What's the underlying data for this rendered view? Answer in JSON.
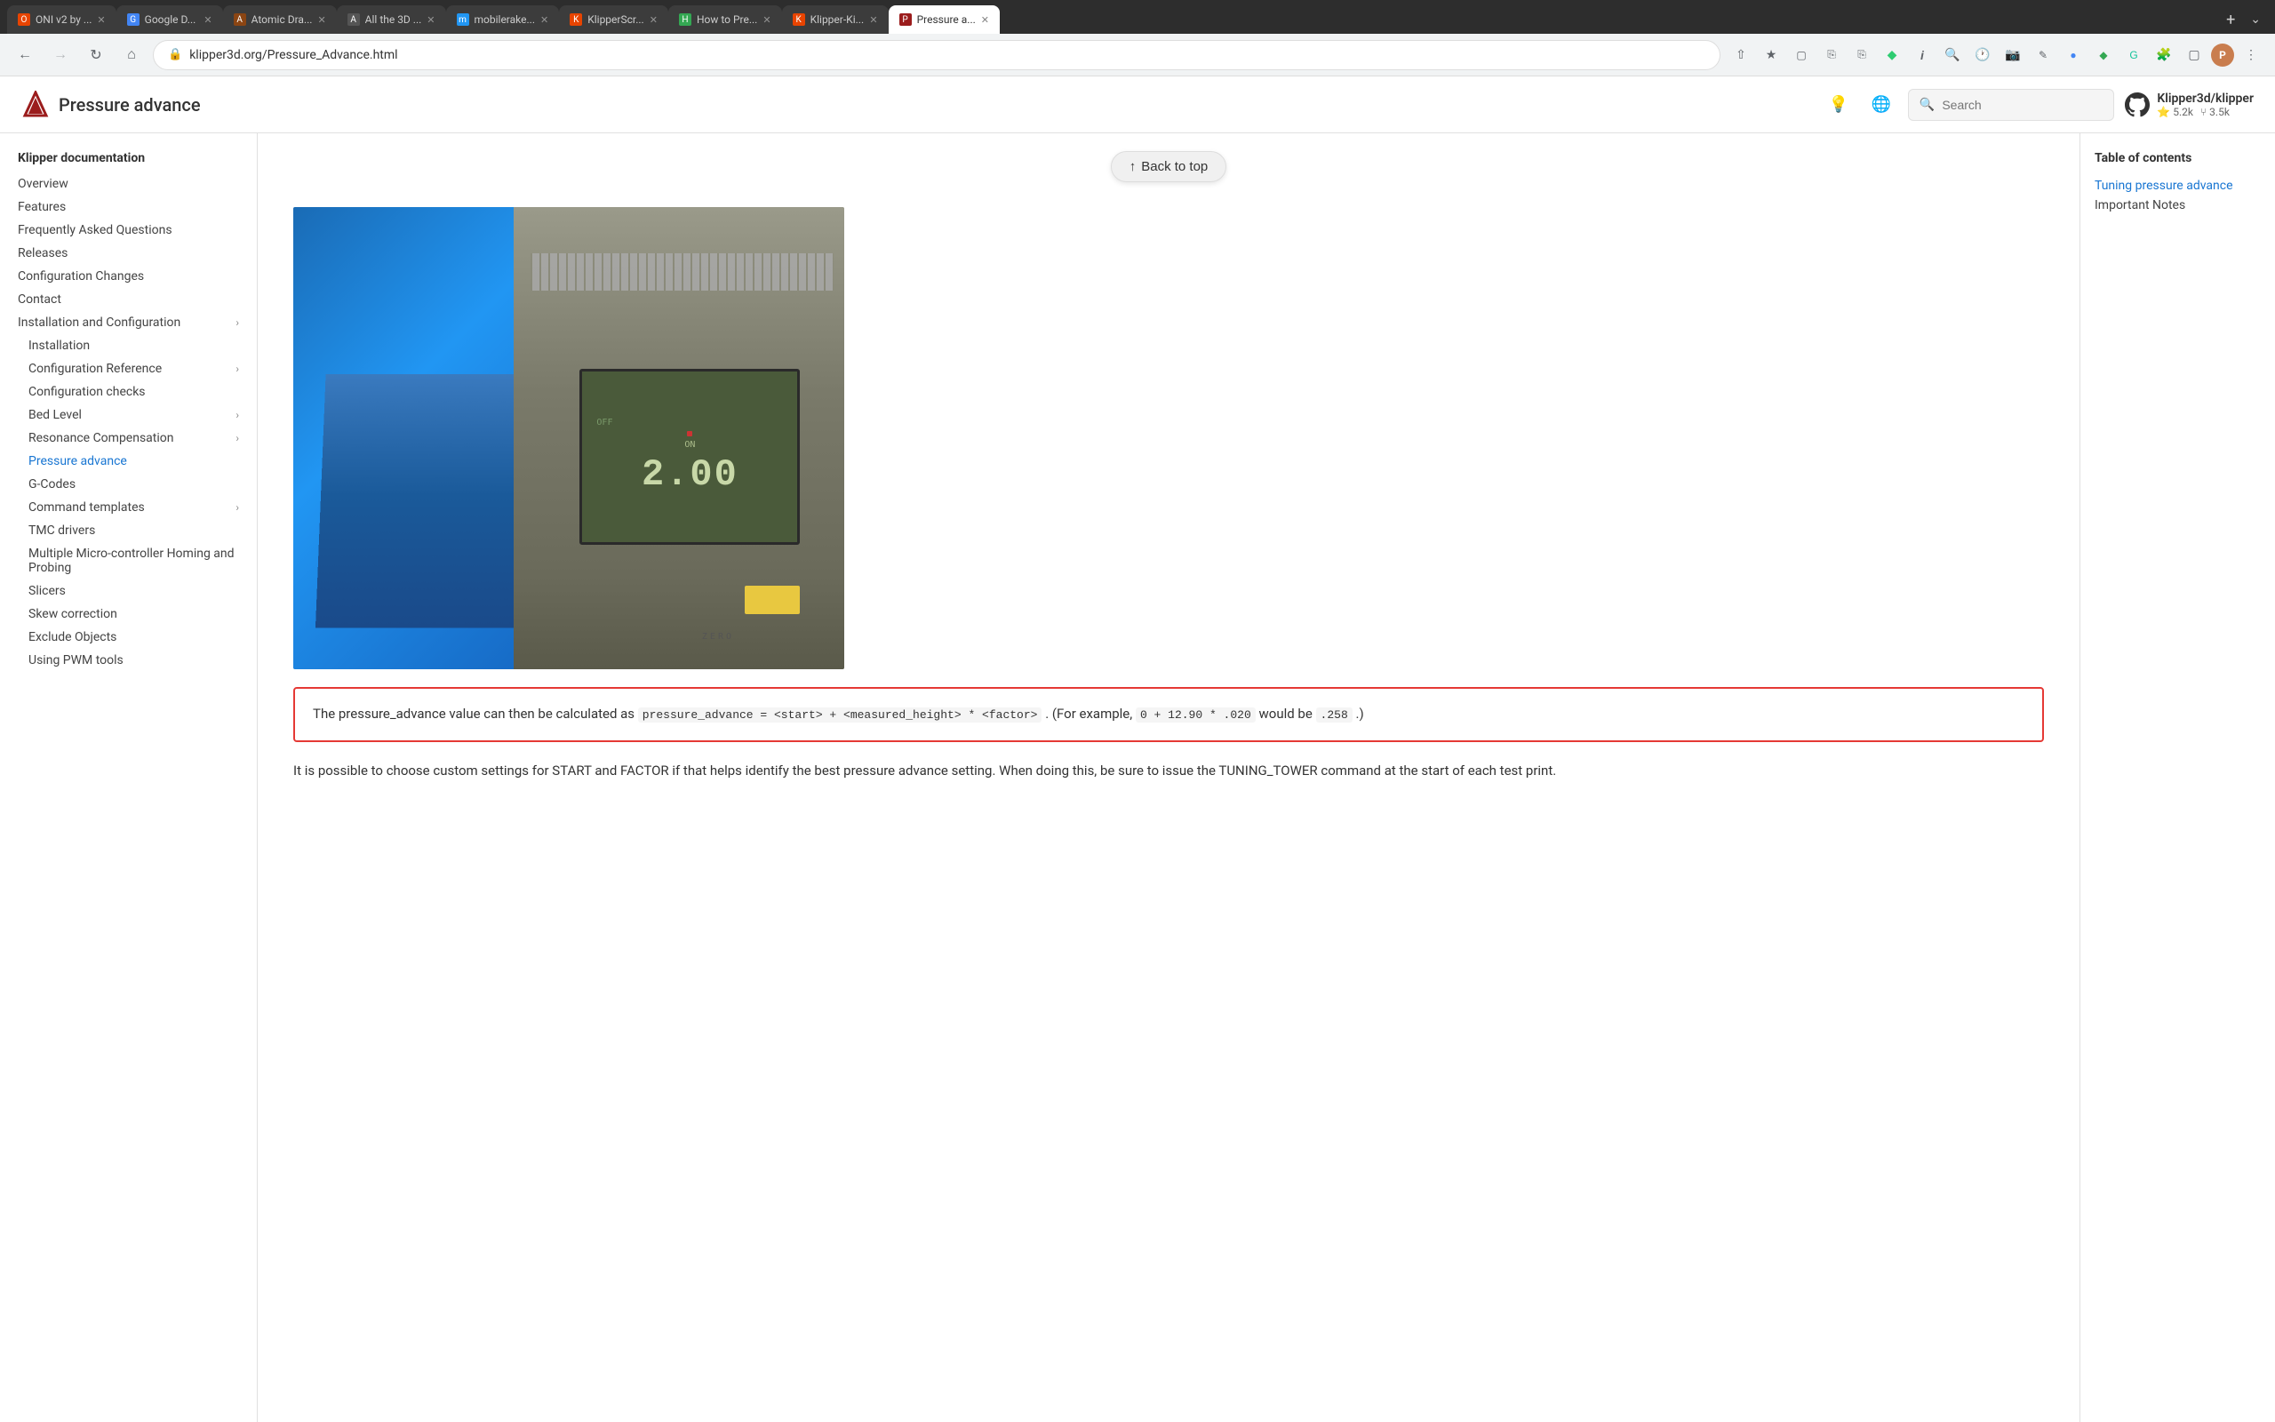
{
  "browser": {
    "tabs": [
      {
        "id": "tab1",
        "favicon_color": "#e84400",
        "favicon_text": "O",
        "label": "ONI v2 by ...",
        "active": false
      },
      {
        "id": "tab2",
        "favicon_color": "#4285f4",
        "favicon_text": "G",
        "label": "Google D...",
        "active": false
      },
      {
        "id": "tab3",
        "favicon_color": "#8B4513",
        "favicon_text": "A",
        "label": "Atomic Dra...",
        "active": false
      },
      {
        "id": "tab4",
        "favicon_color": "#555",
        "favicon_text": "A",
        "label": "All the 3D ...",
        "active": false
      },
      {
        "id": "tab5",
        "favicon_color": "#2196f3",
        "favicon_text": "m",
        "label": "mobilerake...",
        "active": false
      },
      {
        "id": "tab6",
        "favicon_color": "#e84400",
        "favicon_text": "K",
        "label": "KlipperScr...",
        "active": false
      },
      {
        "id": "tab7",
        "favicon_color": "#34a853",
        "favicon_text": "H",
        "label": "How to Pre...",
        "active": false
      },
      {
        "id": "tab8",
        "favicon_color": "#e84400",
        "favicon_text": "K",
        "label": "Klipper-Ki...",
        "active": false
      },
      {
        "id": "tab9",
        "favicon_color": "#9b1c1c",
        "favicon_text": "P",
        "label": "Pressure a...",
        "active": true
      }
    ],
    "url": "klipper3d.org/Pressure_Advance.html",
    "new_tab_label": "+",
    "tab_overflow_label": "⌄"
  },
  "top_nav": {
    "logo_alt": "Klipper",
    "title": "Pressure advance",
    "theme_icon": "💡",
    "lang_icon": "🌐",
    "search_placeholder": "Search",
    "github_icon": "⭕",
    "github_repo": "Klipper3d/klipper",
    "github_stars": "⭐ 5.2k",
    "github_forks": "⑂ 3.5k"
  },
  "sidebar": {
    "section_title": "Klipper documentation",
    "items": [
      {
        "label": "Overview",
        "indent": false,
        "has_chevron": false,
        "active": false
      },
      {
        "label": "Features",
        "indent": false,
        "has_chevron": false,
        "active": false
      },
      {
        "label": "Frequently Asked Questions",
        "indent": false,
        "has_chevron": false,
        "active": false
      },
      {
        "label": "Releases",
        "indent": false,
        "has_chevron": false,
        "active": false
      },
      {
        "label": "Configuration Changes",
        "indent": false,
        "has_chevron": false,
        "active": false
      },
      {
        "label": "Contact",
        "indent": false,
        "has_chevron": false,
        "active": false
      },
      {
        "label": "Installation and Configuration",
        "indent": false,
        "has_chevron": true,
        "active": false
      },
      {
        "label": "Installation",
        "indent": true,
        "has_chevron": false,
        "active": false
      },
      {
        "label": "Configuration Reference",
        "indent": true,
        "has_chevron": true,
        "active": false
      },
      {
        "label": "Configuration checks",
        "indent": true,
        "has_chevron": false,
        "active": false
      },
      {
        "label": "Bed Level",
        "indent": true,
        "has_chevron": true,
        "active": false
      },
      {
        "label": "Resonance Compensation",
        "indent": true,
        "has_chevron": true,
        "active": false
      },
      {
        "label": "Pressure advance",
        "indent": true,
        "has_chevron": false,
        "active": true
      },
      {
        "label": "G-Codes",
        "indent": true,
        "has_chevron": false,
        "active": false
      },
      {
        "label": "Command templates",
        "indent": true,
        "has_chevron": true,
        "active": false
      },
      {
        "label": "TMC drivers",
        "indent": true,
        "has_chevron": false,
        "active": false
      },
      {
        "label": "Multiple Micro-controller Homing and Probing",
        "indent": true,
        "has_chevron": false,
        "active": false
      },
      {
        "label": "Slicers",
        "indent": true,
        "has_chevron": false,
        "active": false
      },
      {
        "label": "Skew correction",
        "indent": true,
        "has_chevron": false,
        "active": false
      },
      {
        "label": "Exclude Objects",
        "indent": true,
        "has_chevron": false,
        "active": false
      },
      {
        "label": "Using PWM tools",
        "indent": true,
        "has_chevron": false,
        "active": false
      }
    ]
  },
  "content": {
    "back_to_top_label": "Back to top",
    "formula_box": {
      "text_before": "The pressure_advance value can then be calculated as",
      "formula": "pressure_advance = <start> + <measured_height> * <factor>",
      "text_middle": ". (For example,",
      "example": "0 + 12.90 * .020",
      "text_end": "would be",
      "result": ".258",
      "period": ".)"
    },
    "body_paragraph": "It is possible to choose custom settings for START and FACTOR if that helps identify the best pressure advance setting. When doing this, be sure to issue the TUNING_TOWER command at the start of each test print."
  },
  "toc": {
    "title": "Table of contents",
    "items": [
      {
        "label": "Tuning pressure advance",
        "active": true
      },
      {
        "label": "Important Notes",
        "active": false
      }
    ]
  }
}
